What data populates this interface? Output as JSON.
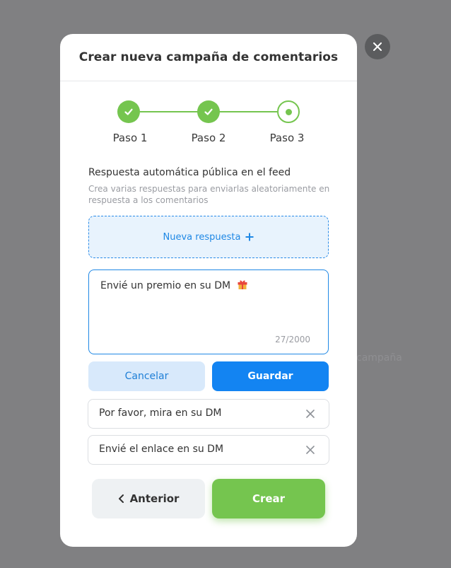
{
  "background": {
    "ghost_text": "campaña"
  },
  "modal": {
    "title": "Crear nueva campaña de comentarios",
    "steps": [
      {
        "label": "Paso 1",
        "state": "done"
      },
      {
        "label": "Paso 2",
        "state": "done"
      },
      {
        "label": "Paso 3",
        "state": "current"
      }
    ],
    "section": {
      "title": "Respuesta automática pública en el feed",
      "subtitle": "Crea varias respuestas para enviarlas aleatoriamente en respuesta a los comentarios"
    },
    "new_response_label": "Nueva respuesta",
    "editor": {
      "value": "Envié un premio en su DM",
      "emoji": "gift-icon",
      "counter": "27/2000"
    },
    "cancel_label": "Cancelar",
    "save_label": "Guardar",
    "responses": [
      "Por favor, mira en su DM",
      "Envié el enlace en su DM"
    ],
    "prev_label": "Anterior",
    "create_label": "Crear"
  },
  "colors": {
    "primary_blue": "#1384f2",
    "success_green": "#75c54f",
    "overlay": "#808082"
  }
}
